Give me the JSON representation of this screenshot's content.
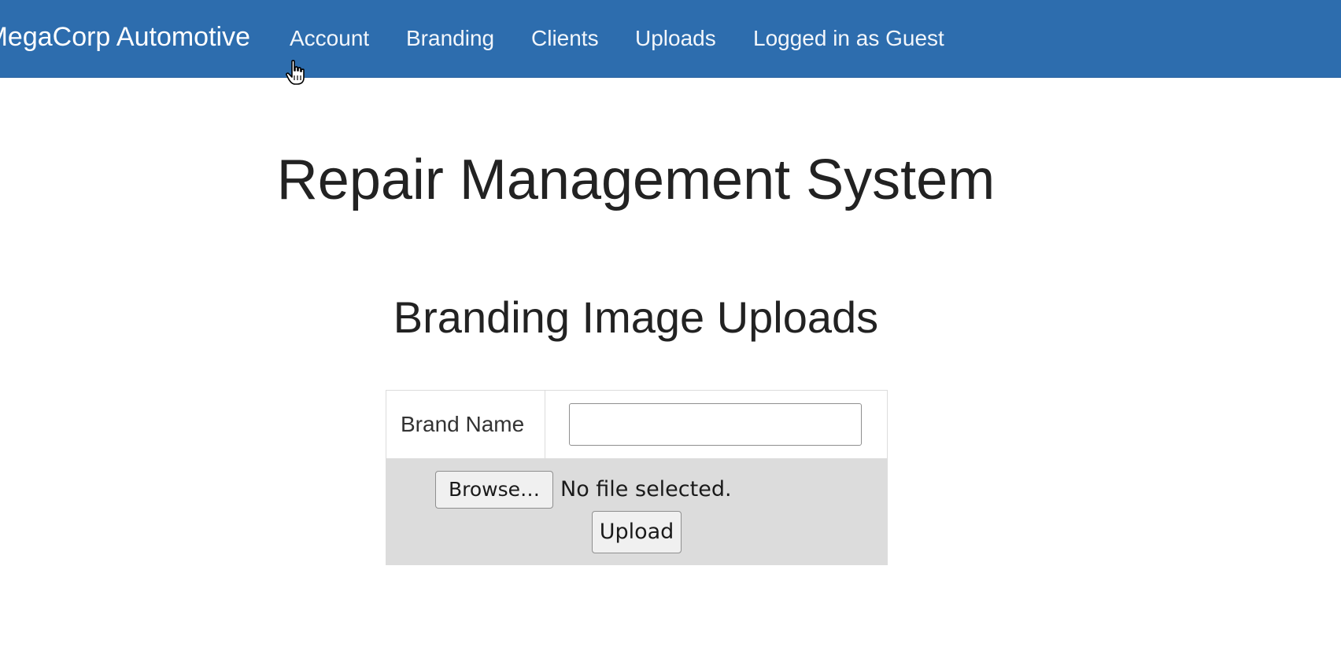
{
  "navbar": {
    "brand": "MegaCorp Automotive",
    "items": [
      {
        "label": "Account"
      },
      {
        "label": "Branding"
      },
      {
        "label": "Clients"
      },
      {
        "label": "Uploads"
      },
      {
        "label": "Logged in as Guest"
      }
    ],
    "background_color": "#2d6dae"
  },
  "main": {
    "title": "Repair Management System",
    "section_title": "Branding Image Uploads"
  },
  "form": {
    "brand_name_label": "Brand Name",
    "brand_name_value": "",
    "browse_label": "Browse…",
    "file_status": "No file selected.",
    "upload_label": "Upload"
  },
  "cursor": {
    "icon": "hand-pointer-icon"
  }
}
